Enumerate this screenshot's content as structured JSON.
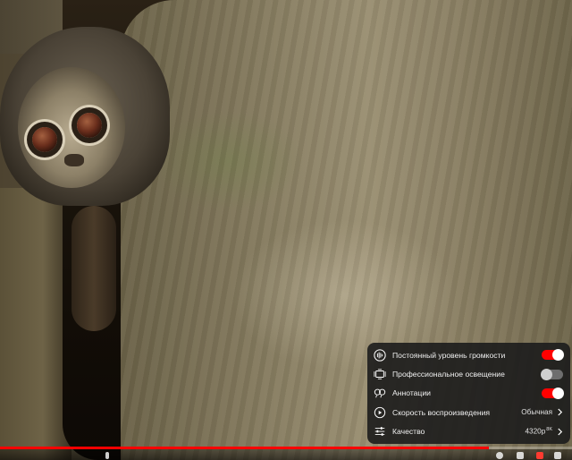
{
  "player": {
    "progress_fraction": 0.855,
    "accent_color": "#ff0000"
  },
  "settings_menu": {
    "items": [
      {
        "icon": "stable-volume-icon",
        "label": "Постоянный уровень громкости",
        "type": "toggle",
        "state": "on"
      },
      {
        "icon": "ambient-mode-icon",
        "label": "Профессиональное освещение",
        "type": "toggle",
        "state": "off"
      },
      {
        "icon": "annotations-icon",
        "label": "Аннотации",
        "type": "toggle",
        "state": "on"
      },
      {
        "icon": "playback-speed-icon",
        "label": "Скорость воспроизведения",
        "type": "submenu",
        "value": "Обычная"
      },
      {
        "icon": "quality-icon",
        "label": "Качество",
        "type": "submenu",
        "value": "4320p",
        "badge": "8K"
      }
    ]
  }
}
